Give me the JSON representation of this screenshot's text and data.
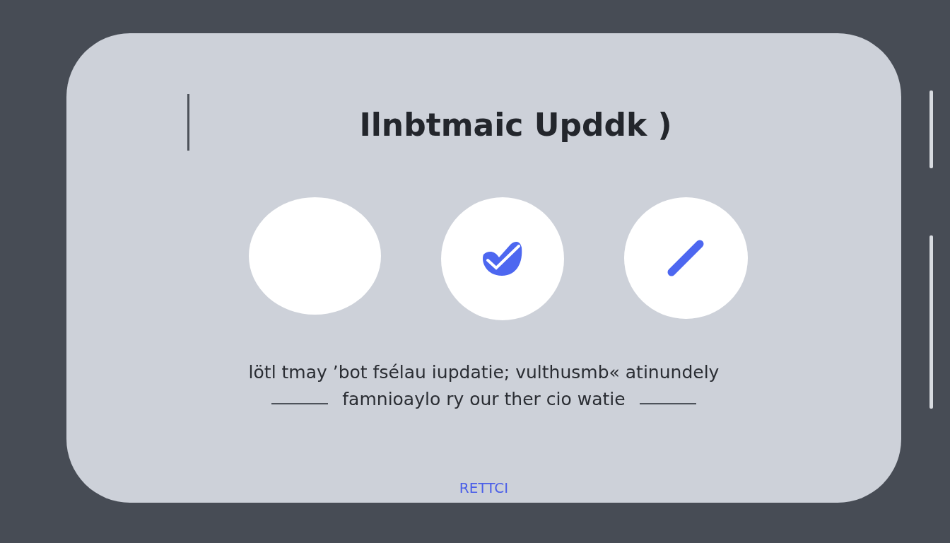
{
  "dialog": {
    "title": "Ilnbtmaic Upddk )",
    "options": [
      {
        "kind": "empty"
      },
      {
        "kind": "check"
      },
      {
        "kind": "line"
      }
    ],
    "message": [
      "lötl tmay ’bot fsélau iupdatie; vulthusmb« atinundely",
      "famnioaylo ry our ther cio watie"
    ],
    "button": "RETTCI"
  }
}
